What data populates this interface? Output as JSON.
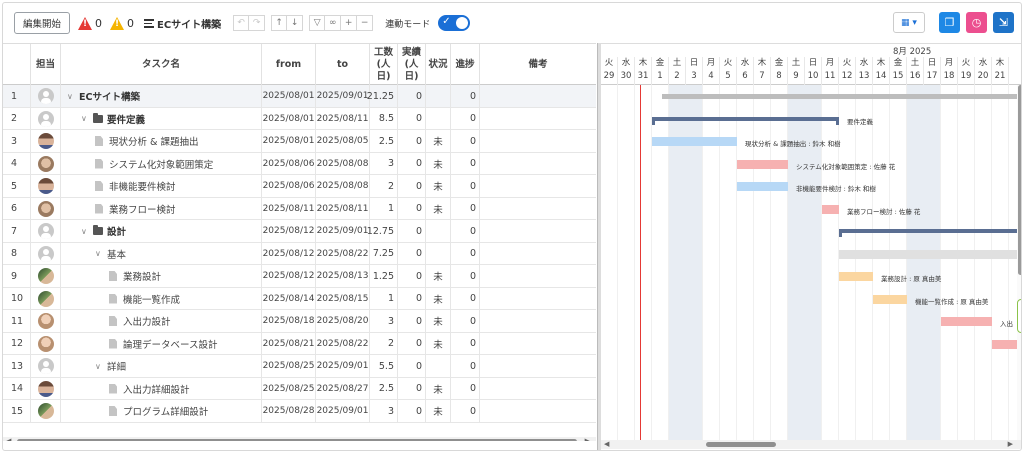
{
  "toolbar": {
    "edit_start": "編集開始",
    "error_count": "0",
    "warning_count": "0",
    "project_name": "ECサイト構築",
    "link_mode_label": "連動モード"
  },
  "grid": {
    "headers": {
      "assignee": "担当",
      "task_name": "タスク名",
      "from": "from",
      "to": "to",
      "effort": "工数 (人日)",
      "actual": "実績 (人日)",
      "status": "状況",
      "progress": "進捗",
      "notes": "備考"
    },
    "rows": [
      {
        "no": "1",
        "avatar": "empty",
        "level": 0,
        "kind": "root",
        "name": "ECサイト構築",
        "from": "2025/08/01",
        "to": "2025/09/01",
        "effort": "21.25",
        "actual": "0",
        "status": "",
        "progress": "0"
      },
      {
        "no": "2",
        "avatar": "empty",
        "level": 1,
        "kind": "folder",
        "name": "要件定義",
        "from": "2025/08/01",
        "to": "2025/08/11",
        "effort": "8.5",
        "actual": "0",
        "status": "",
        "progress": "0"
      },
      {
        "no": "3",
        "avatar": "p1",
        "level": 2,
        "kind": "doc",
        "name": "現状分析 & 課題抽出",
        "from": "2025/08/01",
        "to": "2025/08/05",
        "effort": "2.5",
        "actual": "0",
        "status": "未",
        "progress": "0"
      },
      {
        "no": "4",
        "avatar": "p2",
        "level": 2,
        "kind": "doc",
        "name": "システム化対象範囲策定",
        "from": "2025/08/06",
        "to": "2025/08/08",
        "effort": "3",
        "actual": "0",
        "status": "未",
        "progress": "0"
      },
      {
        "no": "5",
        "avatar": "p1",
        "level": 2,
        "kind": "doc",
        "name": "非機能要件検討",
        "from": "2025/08/06",
        "to": "2025/08/08",
        "effort": "2",
        "actual": "0",
        "status": "未",
        "progress": "0"
      },
      {
        "no": "6",
        "avatar": "p2",
        "level": 2,
        "kind": "doc",
        "name": "業務フロー検討",
        "from": "2025/08/11",
        "to": "2025/08/11",
        "effort": "1",
        "actual": "0",
        "status": "未",
        "progress": "0"
      },
      {
        "no": "7",
        "avatar": "empty",
        "level": 1,
        "kind": "folder",
        "name": "設計",
        "from": "2025/08/12",
        "to": "2025/09/01",
        "effort": "12.75",
        "actual": "0",
        "status": "",
        "progress": "0"
      },
      {
        "no": "8",
        "avatar": "empty",
        "level": 2,
        "kind": "sub",
        "name": "基本",
        "from": "2025/08/12",
        "to": "2025/08/22",
        "effort": "7.25",
        "actual": "0",
        "status": "",
        "progress": "0"
      },
      {
        "no": "9",
        "avatar": "p3",
        "level": 3,
        "kind": "doc",
        "name": "業務設計",
        "from": "2025/08/12",
        "to": "2025/08/13",
        "effort": "1.25",
        "actual": "0",
        "status": "未",
        "progress": "0"
      },
      {
        "no": "10",
        "avatar": "p3",
        "level": 3,
        "kind": "doc",
        "name": "機能一覧作成",
        "from": "2025/08/14",
        "to": "2025/08/15",
        "effort": "1",
        "actual": "0",
        "status": "未",
        "progress": "0"
      },
      {
        "no": "11",
        "avatar": "p4",
        "level": 3,
        "kind": "doc",
        "name": "入出力設計",
        "from": "2025/08/18",
        "to": "2025/08/20",
        "effort": "3",
        "actual": "0",
        "status": "未",
        "progress": "0"
      },
      {
        "no": "12",
        "avatar": "p4",
        "level": 3,
        "kind": "doc",
        "name": "論理データベース設計",
        "from": "2025/08/21",
        "to": "2025/08/22",
        "effort": "2",
        "actual": "0",
        "status": "未",
        "progress": "0"
      },
      {
        "no": "13",
        "avatar": "empty",
        "level": 2,
        "kind": "sub",
        "name": "詳細",
        "from": "2025/08/25",
        "to": "2025/09/01",
        "effort": "5.5",
        "actual": "0",
        "status": "",
        "progress": "0"
      },
      {
        "no": "14",
        "avatar": "p1",
        "level": 3,
        "kind": "doc",
        "name": "入出力詳細設計",
        "from": "2025/08/25",
        "to": "2025/08/27",
        "effort": "2.5",
        "actual": "0",
        "status": "未",
        "progress": "0"
      },
      {
        "no": "15",
        "avatar": "p3",
        "level": 3,
        "kind": "doc",
        "name": "プログラム詳細設計",
        "from": "2025/08/28",
        "to": "2025/09/01",
        "effort": "3",
        "actual": "0",
        "status": "未",
        "progress": "0"
      }
    ]
  },
  "gantt": {
    "month_label": "8月 2025",
    "days": [
      {
        "w": "火",
        "d": "29"
      },
      {
        "w": "水",
        "d": "30"
      },
      {
        "w": "木",
        "d": "31"
      },
      {
        "w": "金",
        "d": "1"
      },
      {
        "w": "土",
        "d": "2"
      },
      {
        "w": "日",
        "d": "3"
      },
      {
        "w": "月",
        "d": "4"
      },
      {
        "w": "火",
        "d": "5"
      },
      {
        "w": "水",
        "d": "6"
      },
      {
        "w": "木",
        "d": "7"
      },
      {
        "w": "金",
        "d": "8"
      },
      {
        "w": "土",
        "d": "9"
      },
      {
        "w": "日",
        "d": "10"
      },
      {
        "w": "月",
        "d": "11"
      },
      {
        "w": "火",
        "d": "12"
      },
      {
        "w": "水",
        "d": "13"
      },
      {
        "w": "木",
        "d": "14"
      },
      {
        "w": "金",
        "d": "15"
      },
      {
        "w": "土",
        "d": "16"
      },
      {
        "w": "日",
        "d": "17"
      },
      {
        "w": "月",
        "d": "18"
      },
      {
        "w": "火",
        "d": "19"
      },
      {
        "w": "水",
        "d": "20"
      },
      {
        "w": "木",
        "d": "21"
      }
    ],
    "bar_labels": [
      "",
      "要件定義",
      "現状分析 & 課題抽出 : 鈴木 和樹",
      "システム化対象範囲策定 : 佐藤 花",
      "非機能要件検討 : 鈴木 和樹",
      "業務フロー検討 : 佐藤 花",
      "",
      "",
      "業務設計 : 原 真由美",
      "機能一覧作成 : 原 真由美",
      "入出",
      "",
      "",
      "",
      ""
    ]
  },
  "colors": {
    "accent": "#1a6fd6",
    "today_line": "#e53935",
    "group_bar": "#5a6e92",
    "weekend": "#e8edf3"
  }
}
